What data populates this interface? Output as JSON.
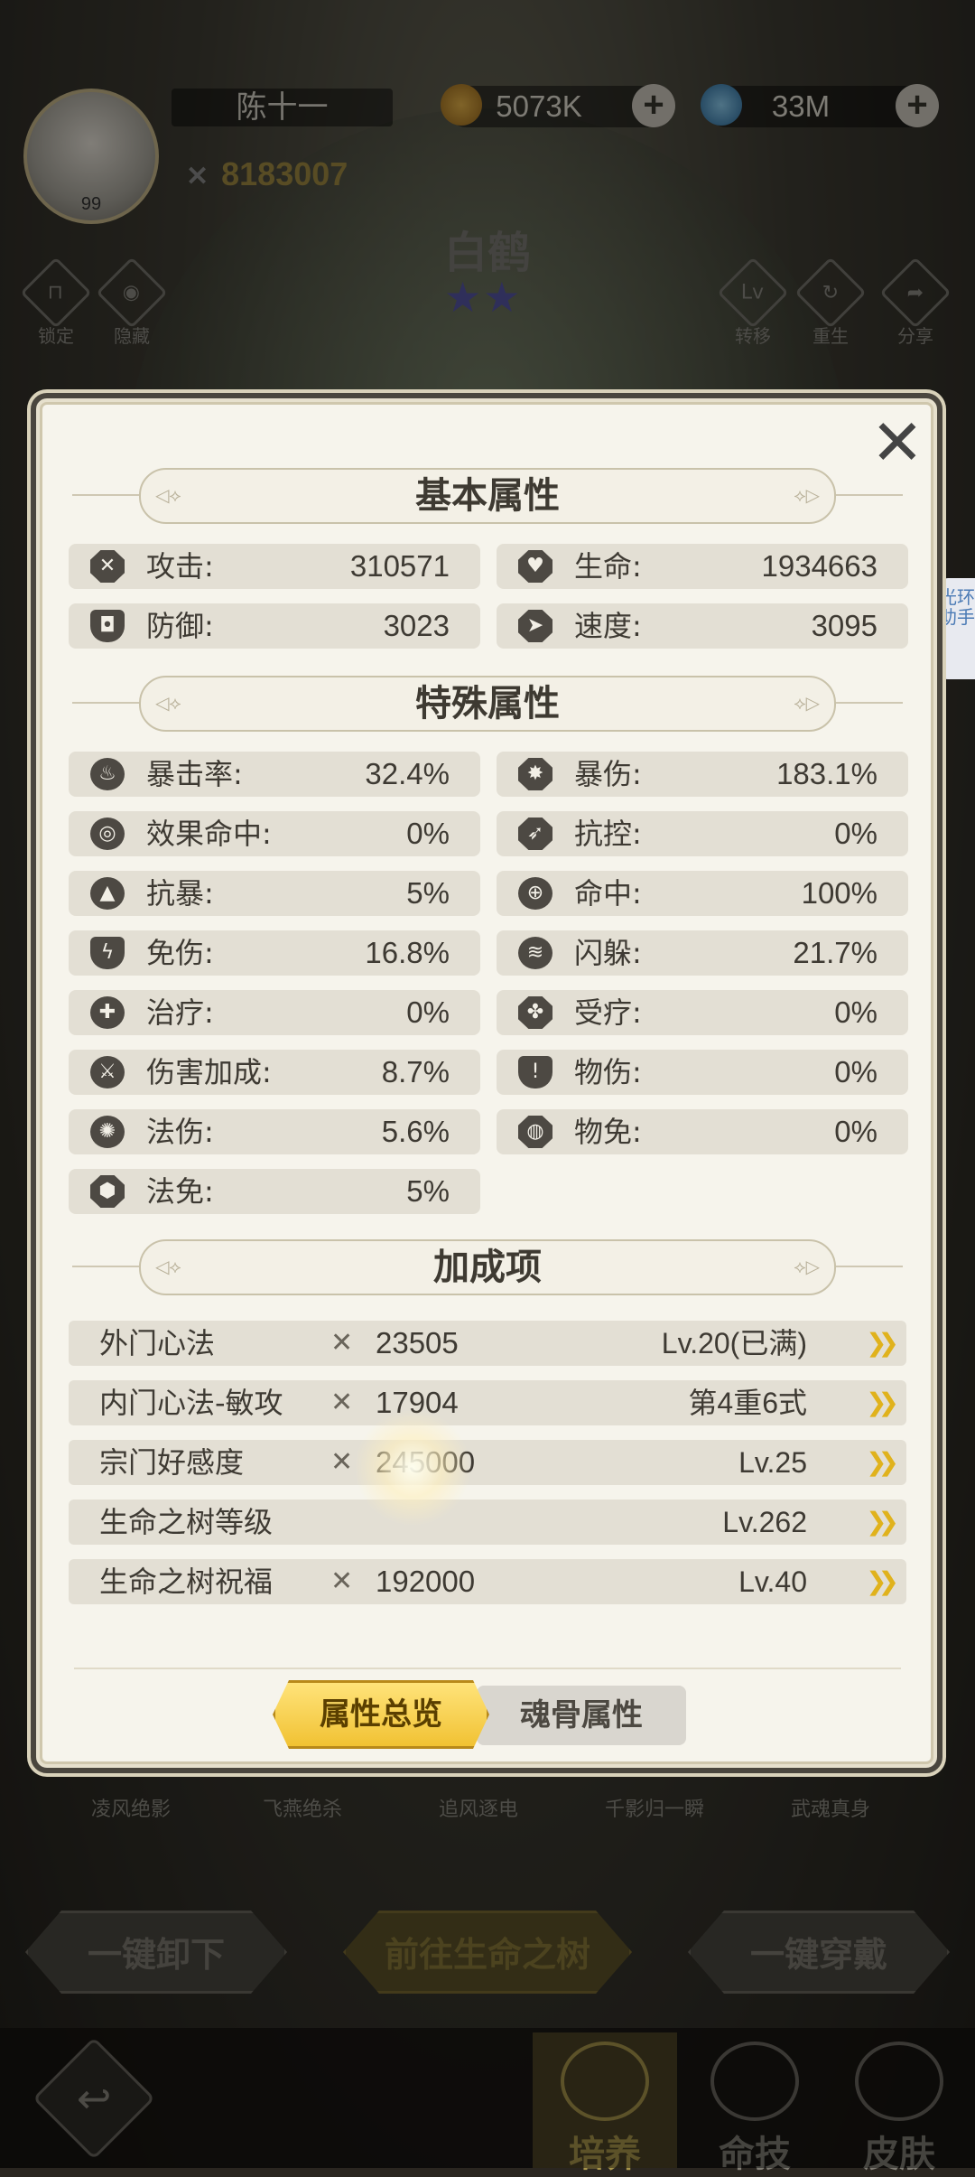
{
  "header": {
    "player_name": "陈十一",
    "avatar_level": "99",
    "coins": "5073K",
    "gems": "33M",
    "combat_power": "8183007",
    "hero_name": "白鹤",
    "stars": "★★",
    "left_buttons": [
      {
        "icon": "lock-icon",
        "label": "锁定"
      },
      {
        "icon": "eye-icon",
        "label": "隐藏"
      }
    ],
    "right_buttons": [
      {
        "icon": "lv-icon",
        "label": "转移",
        "glyph": "Lv"
      },
      {
        "icon": "refresh-icon",
        "label": "重生"
      },
      {
        "icon": "share-icon",
        "label": "分享"
      }
    ]
  },
  "helper_tab": "光环助手",
  "panel": {
    "basic_title": "基本属性",
    "basic": [
      {
        "name": "攻击:",
        "value": "310571",
        "icon": "attack-icon"
      },
      {
        "name": "生命:",
        "value": "1934663",
        "icon": "heart-icon"
      },
      {
        "name": "防御:",
        "value": "3023",
        "icon": "shield-icon"
      },
      {
        "name": "速度:",
        "value": "3095",
        "icon": "speed-icon"
      }
    ],
    "special_title": "特殊属性",
    "special": [
      {
        "name": "暴击率:",
        "value": "32.4%",
        "icon": "crit-rate-icon"
      },
      {
        "name": "暴伤:",
        "value": "183.1%",
        "icon": "crit-damage-icon"
      },
      {
        "name": "效果命中:",
        "value": "0%",
        "icon": "spiral-icon"
      },
      {
        "name": "抗控:",
        "value": "0%",
        "icon": "control-resist-icon"
      },
      {
        "name": "抗暴:",
        "value": "5%",
        "icon": "crit-resist-icon"
      },
      {
        "name": "命中:",
        "value": "100%",
        "icon": "target-icon"
      },
      {
        "name": "免伤:",
        "value": "16.8%",
        "icon": "damage-reduce-icon"
      },
      {
        "name": "闪躲:",
        "value": "21.7%",
        "icon": "dodge-icon"
      },
      {
        "name": "治疗:",
        "value": "0%",
        "icon": "heal-icon"
      },
      {
        "name": "受疗:",
        "value": "0%",
        "icon": "received-heal-icon"
      },
      {
        "name": "伤害加成:",
        "value": "8.7%",
        "icon": "damage-bonus-icon"
      },
      {
        "name": "物伤:",
        "value": "0%",
        "icon": "physical-damage-icon"
      },
      {
        "name": "法伤:",
        "value": "5.6%",
        "icon": "magic-damage-icon"
      },
      {
        "name": "物免:",
        "value": "0%",
        "icon": "physical-resist-icon"
      },
      {
        "name": "法免:",
        "value": "5%",
        "icon": "magic-resist-icon"
      }
    ],
    "bonus_title": "加成项",
    "bonus": [
      {
        "name": "外门心法",
        "power": "23505",
        "level": "Lv.20(已满)"
      },
      {
        "name": "内门心法-敏攻",
        "power": "17904",
        "level": "第4重6式"
      },
      {
        "name": "宗门好感度",
        "power": "245000",
        "level": "Lv.25"
      },
      {
        "name": "生命之树等级",
        "power": "",
        "level": "Lv.262"
      },
      {
        "name": "生命之树祝福",
        "power": "192000",
        "level": "Lv.40"
      }
    ],
    "tab_active": "属性总览",
    "tab_inactive": "魂骨属性"
  },
  "skills": [
    "凌风绝影",
    "飞燕绝杀",
    "追风逐电",
    "千影归一瞬",
    "武魂真身"
  ],
  "actions": {
    "unequip_all": "一键卸下",
    "goto_tree": "前往生命之树",
    "equip_all": "一键穿戴"
  },
  "nav": [
    {
      "label": "培养",
      "active": true
    },
    {
      "label": "命技",
      "active": false
    },
    {
      "label": "皮肤",
      "active": false
    }
  ]
}
